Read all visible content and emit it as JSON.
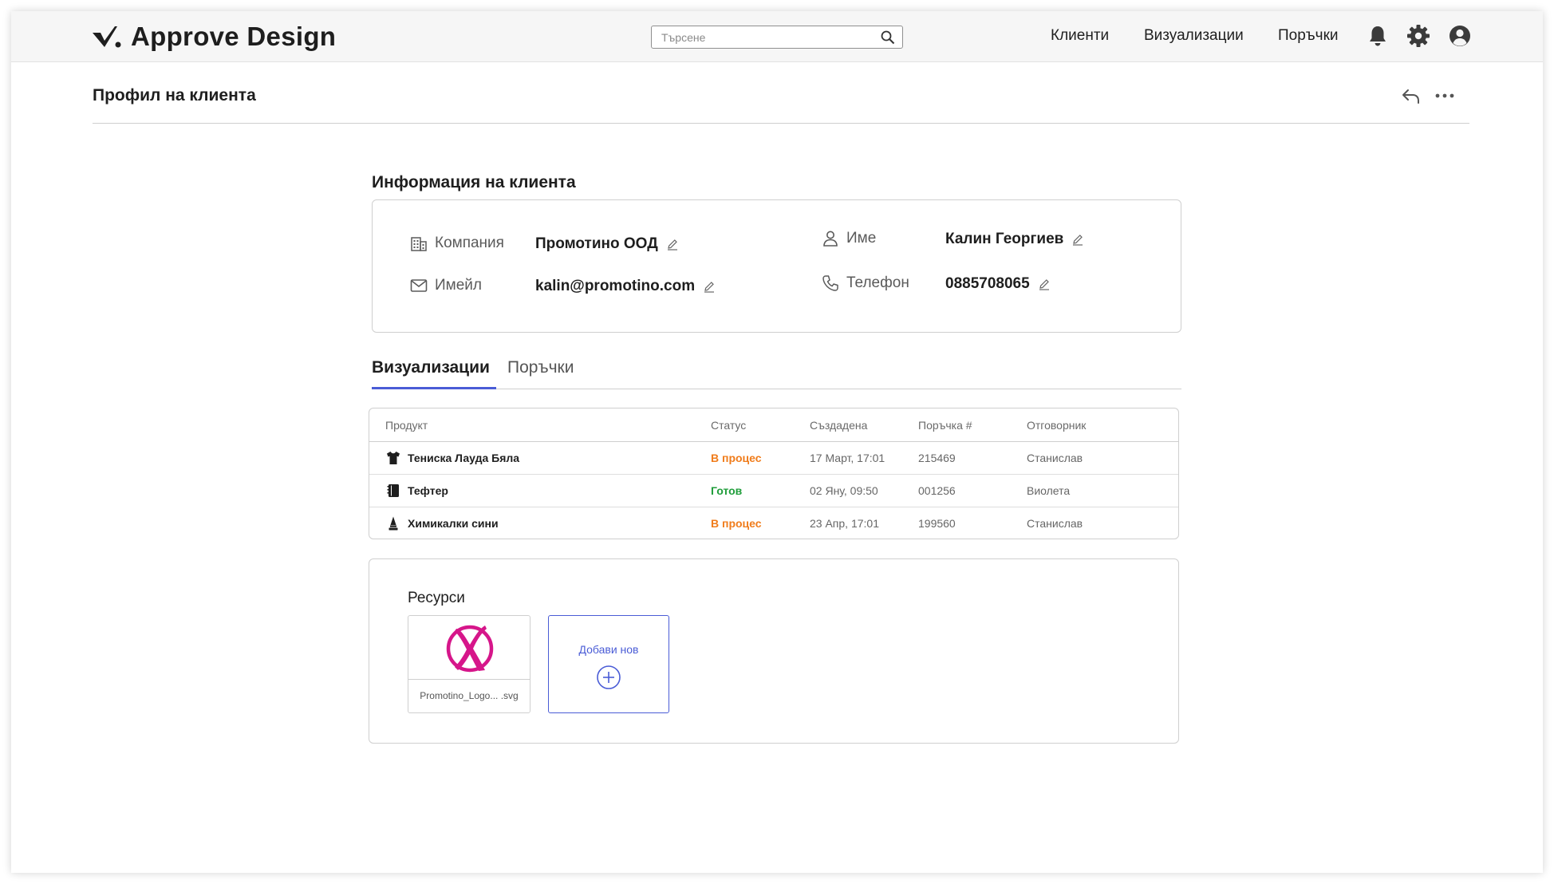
{
  "app": {
    "name": "Approve Design"
  },
  "search": {
    "placeholder": "Търсене"
  },
  "nav": {
    "clients": "Клиенти",
    "visualizations": "Визуализации",
    "orders": "Поръчки"
  },
  "page": {
    "title": "Профил на клиента"
  },
  "client": {
    "section_title": "Информация на клиента",
    "company_label": "Компания",
    "company_value": "Промотино ООД",
    "email_label": "Имейл",
    "email_value": "kalin@promotino.com",
    "name_label": "Име",
    "name_value": "Калин Георгиев",
    "phone_label": "Телефон",
    "phone_value": "0885708065"
  },
  "tabs": [
    {
      "label": "Визуализации",
      "active": true
    },
    {
      "label": "Поръчки",
      "active": false
    }
  ],
  "table": {
    "headers": [
      "Продукт",
      "Статус",
      "Създадена",
      "Поръчка #",
      "Отговорник"
    ],
    "rows": [
      {
        "product": "Тениска Лауда Бяла",
        "icon": "tshirt-icon",
        "status": "В процес",
        "created": "17 Март, 17:01",
        "order": "215469",
        "owner": "Станислав"
      },
      {
        "product": "Тефтер",
        "icon": "notebook-icon",
        "status": "Готов",
        "created": "02 Яну, 09:50",
        "order": "001256",
        "owner": "Виолета"
      },
      {
        "product": "Химикалки сини",
        "icon": "pen-icon",
        "status": "В процес",
        "created": "23 Апр, 17:01",
        "order": "199560",
        "owner": "Станислав"
      }
    ]
  },
  "resources": {
    "title": "Ресурси",
    "files": [
      {
        "name": "Promotino_Logo... .svg"
      }
    ],
    "add_label": "Добави нов"
  },
  "colors": {
    "accent": "#4a5cd6",
    "status_in_progress": "#f07c1b",
    "status_ready": "#1f9d3a",
    "logo_magenta": "#d6168a"
  }
}
